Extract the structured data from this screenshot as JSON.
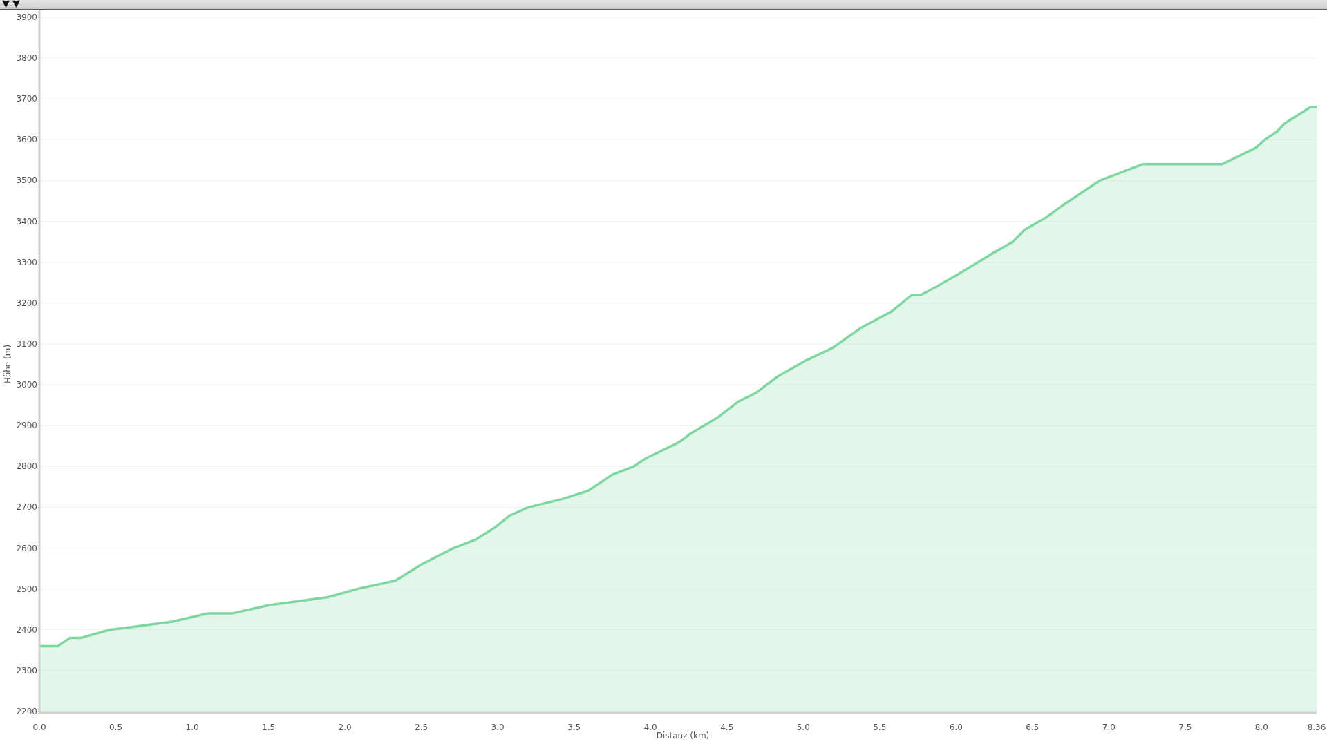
{
  "toolbar": {
    "markers": [
      {
        "kind": "marker"
      },
      {
        "kind": "marker"
      }
    ]
  },
  "chart_data": {
    "type": "area",
    "xlabel": "Distanz (km)",
    "ylabel": "Höhe (m)",
    "x": [
      0,
      0.12,
      0.2,
      0.27,
      0.46,
      0.57,
      0.87,
      1.1,
      1.26,
      1.5,
      1.89,
      2.08,
      2.33,
      2.5,
      2.71,
      2.85,
      2.98,
      3.08,
      3.2,
      3.42,
      3.59,
      3.75,
      3.89,
      3.97,
      4.19,
      4.26,
      4.35,
      4.44,
      4.58,
      4.69,
      4.83,
      5.02,
      5.19,
      5.38,
      5.58,
      5.71,
      5.77,
      5.87,
      6.01,
      6.23,
      6.37,
      6.45,
      6.59,
      6.7,
      6.94,
      7.22,
      7.74,
      7.96,
      8.02,
      8.1,
      8.15,
      8.32,
      8.36
    ],
    "series": [
      {
        "color": "#7ed7a0",
        "values": [
          2360,
          2360,
          2380,
          2380,
          2400,
          2405,
          2420,
          2440,
          2440,
          2460,
          2480,
          2500,
          2520,
          2560,
          2600,
          2620,
          2650,
          2680,
          2700,
          2720,
          2740,
          2780,
          2800,
          2820,
          2860,
          2880,
          2900,
          2920,
          2960,
          2980,
          3020,
          3060,
          3090,
          3140,
          3180,
          3220,
          3220,
          3240,
          3270,
          3320,
          3350,
          3380,
          3410,
          3440,
          3500,
          3540,
          3540,
          3580,
          3600,
          3620,
          3640,
          3680,
          3680
        ]
      }
    ],
    "grid": true,
    "xlim": [
      0,
      8.36
    ],
    "ylim": [
      2200,
      3900
    ],
    "xticks": [
      {
        "value": 0,
        "label": "0.0"
      },
      {
        "value": 0.5,
        "label": "0.5"
      },
      {
        "value": 1,
        "label": "1.0"
      },
      {
        "value": 1.5,
        "label": "1.5"
      },
      {
        "value": 2,
        "label": "2.0"
      },
      {
        "value": 2.5,
        "label": "2.5"
      },
      {
        "value": 3,
        "label": "3.0"
      },
      {
        "value": 3.5,
        "label": "3.5"
      },
      {
        "value": 4,
        "label": "4.0"
      },
      {
        "value": 4.5,
        "label": "4.5"
      },
      {
        "value": 5,
        "label": "5.0"
      },
      {
        "value": 5.5,
        "label": "5.5"
      },
      {
        "value": 6,
        "label": "6.0"
      },
      {
        "value": 6.5,
        "label": "6.5"
      },
      {
        "value": 7,
        "label": "7.0"
      },
      {
        "value": 7.5,
        "label": "7.5"
      },
      {
        "value": 8,
        "label": "8.0"
      },
      {
        "value": 8.36,
        "label": "8.36"
      }
    ],
    "yticks": [
      2200,
      2300,
      2400,
      2500,
      2600,
      2700,
      2800,
      2900,
      3000,
      3100,
      3200,
      3300,
      3400,
      3500,
      3600,
      3700,
      3800,
      3900
    ]
  }
}
